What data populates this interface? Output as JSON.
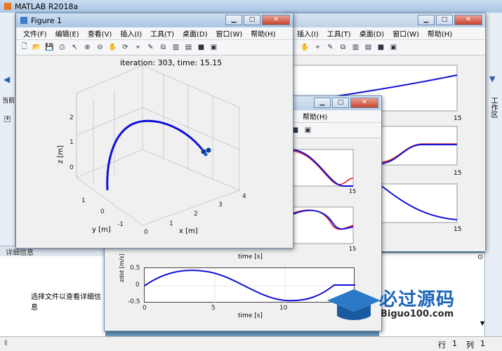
{
  "app": {
    "title": "MATLAB R2018a"
  },
  "figure1": {
    "title": "Figure 1",
    "menu": [
      "文件(F)",
      "编辑(E)",
      "查看(V)",
      "插入(I)",
      "工具(T)",
      "桌面(D)",
      "窗口(W)",
      "帮助(H)"
    ],
    "plot_title": "iteration: 303, time: 15.15",
    "zlabel": "z [m]",
    "ylabel": "y [m]",
    "xlabel": "x [m]",
    "z_ticks": [
      "2",
      "1",
      "0"
    ],
    "y_ticks": [
      "1",
      "0",
      "-1"
    ],
    "x_ticks": [
      "0",
      "1",
      "2",
      "3",
      "4"
    ]
  },
  "back_figure": {
    "menu": [
      "插入(I)",
      "工具(T)",
      "桌面(D)",
      "窗口(W)",
      "帮助(H)"
    ],
    "x_tick": "15"
  },
  "mid_figure": {
    "menu_help": "帮助(H)",
    "xlabel": "time [s]",
    "bottom_ylabel": "zdot [m/s]",
    "y_ticks": [
      "0.5",
      "0",
      "-0.5"
    ],
    "x_ticks": [
      "0",
      "5",
      "10",
      "15"
    ],
    "small_tick": "15"
  },
  "left_panel": {
    "header": "详细信息",
    "message": "选择文件以查看详细信息",
    "partial_label": "当前"
  },
  "right_panel": {
    "label": "工作区"
  },
  "statusbar": {
    "row_label": "行",
    "row_value": "1",
    "col_label": "列",
    "col_value": "1"
  },
  "watermark": {
    "main": "必过源码",
    "sub": "Biguo100.com"
  },
  "colors": {
    "blue": "#1010d8",
    "red": "#e02020",
    "titlebar": "#b7cfe8"
  },
  "chart_data": [
    {
      "type": "line",
      "title": "iteration: 303, time: 15.15",
      "xlabel": "x [m]",
      "ylabel": "y [m]",
      "zlabel": "z [m]",
      "series": [
        {
          "values": [
            [
              0,
              0,
              0
            ],
            [
              0.3,
              0,
              1.5
            ],
            [
              1.2,
              0,
              2.1
            ],
            [
              2.3,
              0,
              1.8
            ],
            [
              3.2,
              0,
              0.7
            ]
          ]
        }
      ]
    },
    {
      "type": "line",
      "xlabel": "time [s]",
      "ylabel": "zdot [m/s]",
      "ylim": [
        -0.5,
        0.5
      ],
      "x": [
        0,
        2.5,
        5,
        7.5,
        10,
        12.5,
        14,
        15
      ],
      "series": [
        {
          "values": [
            0,
            0.42,
            0.28,
            -0.2,
            -0.42,
            -0.1,
            0,
            0
          ]
        }
      ]
    }
  ]
}
